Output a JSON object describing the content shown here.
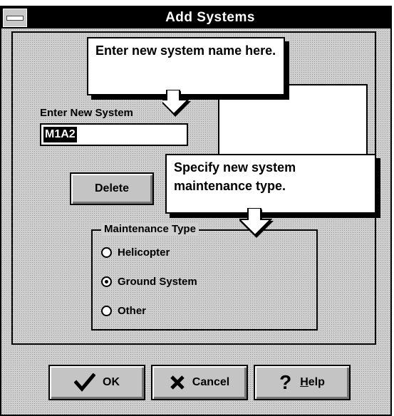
{
  "window": {
    "title": "Add Systems"
  },
  "form": {
    "new_system_label": "Enter New System",
    "new_system_value": "M1A2",
    "delete_label": "Delete"
  },
  "maintenance": {
    "group_label": "Maintenance Type",
    "options": [
      {
        "label": "Helicopter",
        "checked": false
      },
      {
        "label": "Ground System",
        "checked": true
      },
      {
        "label": "Other",
        "checked": false
      }
    ]
  },
  "callouts": {
    "system_name": "Enter new system name here.",
    "maintenance_type": "Specify new system maintenance type."
  },
  "buttons": {
    "ok": "OK",
    "cancel": "Cancel",
    "help_prefix": "",
    "help_underlined": "H",
    "help_rest": "elp"
  },
  "icons": {
    "ok": "checkmark-icon",
    "cancel": "x-icon",
    "help": "question-mark-icon",
    "system_menu": "system-menu-icon"
  }
}
